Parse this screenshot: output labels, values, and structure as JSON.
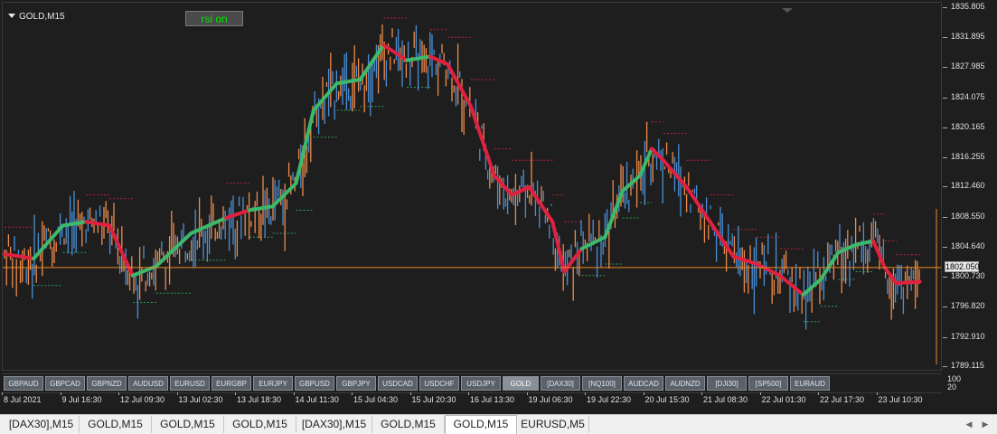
{
  "window": {
    "title": "GOLD,M15",
    "indicator_button": "rsi on",
    "current_price": "1802.050",
    "indicator_scale": {
      "top": "100",
      "bottom": "20"
    }
  },
  "price_axis": {
    "ticks": [
      "1835.805",
      "1831.895",
      "1827.985",
      "1824.075",
      "1820.165",
      "1816.255",
      "1812.460",
      "1808.550",
      "1804.640",
      "1800.730",
      "1796.820",
      "1792.910",
      "1789.115"
    ]
  },
  "time_axis": {
    "ticks": [
      "8 Jul 2021",
      "9 Jul 16:30",
      "12 Jul 09:30",
      "13 Jul 02:30",
      "13 Jul 18:30",
      "14 Jul 11:30",
      "15 Jul 04:30",
      "15 Jul 20:30",
      "16 Jul 13:30",
      "19 Jul 06:30",
      "19 Jul 22:30",
      "20 Jul 15:30",
      "21 Jul 08:30",
      "22 Jul 01:30",
      "22 Jul 17:30",
      "23 Jul 10:30"
    ]
  },
  "symbols": [
    "GBPAUD",
    "GBPCAD",
    "GBPNZD",
    "AUDUSD",
    "EURUSD",
    "EURGBP",
    "EURJPY",
    "GBPUSD",
    "GBPJPY",
    "USDCAD",
    "USDCHF",
    "USDJPY",
    "GOLD",
    "[DAX30]",
    "[NQ100]",
    "AUDCAD",
    "AUDNZD",
    "[DJI30]",
    "[SP500]",
    "EURAUD"
  ],
  "active_symbol": "GOLD",
  "tabs": [
    "[DAX30],M15",
    "GOLD,M15",
    "GOLD,M15",
    "GOLD,M15",
    "[DAX30],M15",
    "GOLD,M15",
    "GOLD,M15",
    "EURUSD,M5"
  ],
  "active_tab_index": 6,
  "colors": {
    "candle_up": "#4a8fd6",
    "candle_down": "#ee8a4a",
    "ma_up": "#3cb96a",
    "ma_down": "#e0203f",
    "stop_line_up": "#2e9e58",
    "stop_line_down": "#c0203c",
    "price_line": "#f08a24",
    "background": "#1e1e1e"
  },
  "chart_data": {
    "type": "line",
    "x": [
      "8 Jul 2021",
      "9 Jul 16:30",
      "12 Jul 09:30",
      "13 Jul 02:30",
      "13 Jul 18:30",
      "14 Jul 11:30",
      "15 Jul 04:30",
      "15 Jul 20:30",
      "16 Jul 13:30",
      "19 Jul 06:30",
      "19 Jul 22:30",
      "20 Jul 15:30",
      "21 Jul 08:30",
      "22 Jul 01:30",
      "22 Jul 17:30",
      "23 Jul 10:30"
    ],
    "ylim": [
      1788.5,
      1836.5
    ],
    "ma_series": [
      {
        "x": 0,
        "y": 1803.8,
        "trend": "down"
      },
      {
        "x": 0.5,
        "y": 1803.2,
        "trend": "down"
      },
      {
        "x": 1,
        "y": 1807.5,
        "trend": "up"
      },
      {
        "x": 1.4,
        "y": 1808.0,
        "trend": "up"
      },
      {
        "x": 1.8,
        "y": 1807.5,
        "trend": "down"
      },
      {
        "x": 2.2,
        "y": 1801.0,
        "trend": "down"
      },
      {
        "x": 2.6,
        "y": 1802.2,
        "trend": "up"
      },
      {
        "x": 3.2,
        "y": 1806.5,
        "trend": "up"
      },
      {
        "x": 3.8,
        "y": 1808.5,
        "trend": "up"
      },
      {
        "x": 4.2,
        "y": 1809.5,
        "trend": "down"
      },
      {
        "x": 4.6,
        "y": 1810.0,
        "trend": "up"
      },
      {
        "x": 5.0,
        "y": 1813.0,
        "trend": "up"
      },
      {
        "x": 5.3,
        "y": 1822.5,
        "trend": "up"
      },
      {
        "x": 5.7,
        "y": 1826.0,
        "trend": "up"
      },
      {
        "x": 6.1,
        "y": 1826.5,
        "trend": "up"
      },
      {
        "x": 6.5,
        "y": 1831.0,
        "trend": "up"
      },
      {
        "x": 6.9,
        "y": 1829.0,
        "trend": "down"
      },
      {
        "x": 7.3,
        "y": 1829.5,
        "trend": "up"
      },
      {
        "x": 7.6,
        "y": 1828.5,
        "trend": "down"
      },
      {
        "x": 8.0,
        "y": 1823.0,
        "trend": "down"
      },
      {
        "x": 8.4,
        "y": 1814.0,
        "trend": "down"
      },
      {
        "x": 8.7,
        "y": 1811.5,
        "trend": "down"
      },
      {
        "x": 9.0,
        "y": 1812.5,
        "trend": "down"
      },
      {
        "x": 9.4,
        "y": 1808.0,
        "trend": "down"
      },
      {
        "x": 9.6,
        "y": 1801.5,
        "trend": "down"
      },
      {
        "x": 9.9,
        "y": 1804.5,
        "trend": "down"
      },
      {
        "x": 10.3,
        "y": 1806.0,
        "trend": "up"
      },
      {
        "x": 10.6,
        "y": 1812.0,
        "trend": "up"
      },
      {
        "x": 10.9,
        "y": 1814.0,
        "trend": "up"
      },
      {
        "x": 11.1,
        "y": 1817.5,
        "trend": "up"
      },
      {
        "x": 11.3,
        "y": 1816.0,
        "trend": "down"
      },
      {
        "x": 11.7,
        "y": 1812.5,
        "trend": "down"
      },
      {
        "x": 12.1,
        "y": 1808.0,
        "trend": "down"
      },
      {
        "x": 12.5,
        "y": 1803.5,
        "trend": "down"
      },
      {
        "x": 12.9,
        "y": 1802.5,
        "trend": "down"
      },
      {
        "x": 13.3,
        "y": 1801.0,
        "trend": "down"
      },
      {
        "x": 13.7,
        "y": 1798.5,
        "trend": "down"
      },
      {
        "x": 14.0,
        "y": 1800.5,
        "trend": "up"
      },
      {
        "x": 14.3,
        "y": 1804.0,
        "trend": "up"
      },
      {
        "x": 14.6,
        "y": 1805.0,
        "trend": "up"
      },
      {
        "x": 14.9,
        "y": 1805.5,
        "trend": "up"
      },
      {
        "x": 15.1,
        "y": 1802.0,
        "trend": "down"
      },
      {
        "x": 15.3,
        "y": 1800.0,
        "trend": "down"
      },
      {
        "x": 15.7,
        "y": 1800.2,
        "trend": "down"
      }
    ]
  }
}
